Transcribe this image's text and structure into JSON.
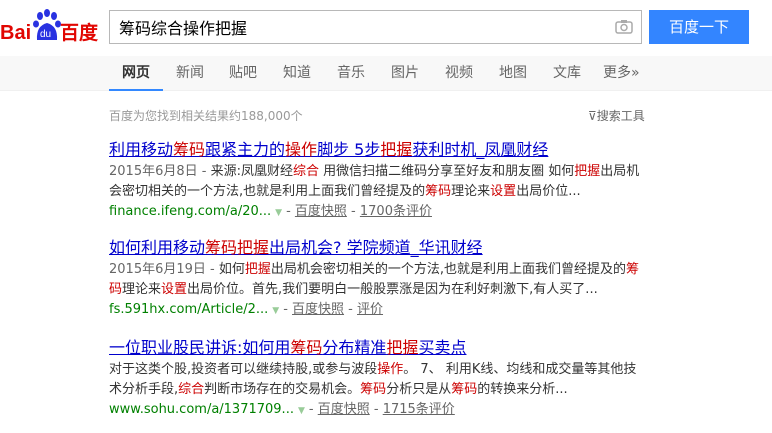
{
  "logo": {
    "text_bai": "Bai",
    "text_du": "du",
    "text_cn": "百度"
  },
  "search": {
    "query": "筹码综合操作把握",
    "button": "百度一下"
  },
  "nav": {
    "tabs": [
      "网页",
      "新闻",
      "贴吧",
      "知道",
      "音乐",
      "图片",
      "视频",
      "地图",
      "文库",
      "更多»"
    ]
  },
  "stats": "百度为您找到相关结果约188,000个",
  "tools": "搜索工具",
  "results": [
    {
      "title": [
        [
          "利用移动",
          0
        ],
        [
          "筹码",
          1
        ],
        [
          "跟紧主力的",
          0
        ],
        [
          "操作",
          1
        ],
        [
          "脚步 5步",
          0
        ],
        [
          "把握",
          1
        ],
        [
          "获利时机_凤凰财经",
          0
        ]
      ],
      "date": "2015年6月8日 - ",
      "abstract": [
        [
          "来源:凤凰财经",
          0
        ],
        [
          "综合",
          1
        ],
        [
          " 用微信扫描二维码分享至好友和朋友圈 如何",
          0
        ],
        [
          "把握",
          1
        ],
        [
          "出局机会密切相关的一个方法,也就是利用上面我们曾经提及的",
          0
        ],
        [
          "筹码",
          1
        ],
        [
          "理论来",
          0
        ],
        [
          "设置",
          1
        ],
        [
          "出局价位...",
          0
        ]
      ],
      "url": "finance.ifeng.com/a/20...",
      "snapshot": "百度快照",
      "comments": "1700条评价"
    },
    {
      "title": [
        [
          "如何利用移动",
          0
        ],
        [
          "筹码把握",
          1
        ],
        [
          "出局机会? 学院频道_华讯财经",
          0
        ]
      ],
      "date": "2015年6月19日 - ",
      "abstract": [
        [
          "如何",
          0
        ],
        [
          "把握",
          1
        ],
        [
          "出局机会密切相关的一个方法,也就是利用上面我们曾经提及的",
          0
        ],
        [
          "筹码",
          1
        ],
        [
          "理论来",
          0
        ],
        [
          "设置",
          1
        ],
        [
          "出局价位。首先,我们要明白一般股票涨是因为在利好刺激下,有人买了...",
          0
        ]
      ],
      "url": "fs.591hx.com/Article/2...",
      "snapshot": "百度快照",
      "comments": "评价"
    },
    {
      "title": [
        [
          "一位职业股民讲诉:如何用",
          0
        ],
        [
          "筹码",
          1
        ],
        [
          "分布精准",
          0
        ],
        [
          "把握",
          1
        ],
        [
          "买卖点",
          0
        ]
      ],
      "date": "",
      "abstract": [
        [
          "对于这类个股,投资者可以继续持股,或参与波段",
          0
        ],
        [
          "操作",
          1
        ],
        [
          "。 7、 利用K线、均线和成交量等其他技术分析手段,",
          0
        ],
        [
          "综合",
          1
        ],
        [
          "判断市场存在的交易机会。",
          0
        ],
        [
          "筹码",
          1
        ],
        [
          "分析只是从",
          0
        ],
        [
          "筹码",
          1
        ],
        [
          "的转换来分析...",
          0
        ]
      ],
      "url": "www.sohu.com/a/1371709...",
      "snapshot": "百度快照",
      "comments": "1715条评价"
    }
  ]
}
